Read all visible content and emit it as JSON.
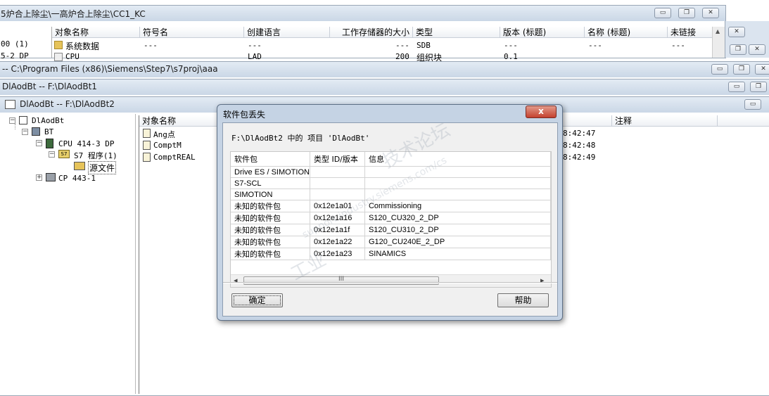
{
  "win1": {
    "title": "5炉合上除尘\\一高炉合上除尘\\CC1_KC",
    "columns": [
      "对象名称",
      "符号名",
      "创建语言",
      "工作存储器的大小",
      "类型",
      "版本 (标题)",
      "名称 (标题)",
      "未链接"
    ],
    "row1": {
      "name": "系统数据",
      "symbol": "---",
      "lang": "---",
      "size": "---",
      "type": "SDB",
      "version": "---",
      "title_name": "---",
      "unlinked": "---"
    },
    "row2": {
      "name": "CPU",
      "lang": "LAD",
      "size": "200",
      "type": "组织块",
      "version": "0.1"
    },
    "left_items": [
      "00 (1)",
      "5-2 DP"
    ]
  },
  "win2": {
    "title": "-- C:\\Program Files (x86)\\Siemens\\Step7\\s7proj\\aaa"
  },
  "win3": {
    "title": "DlAodBt -- F:\\DlAodBt1"
  },
  "win4": {
    "title": "DlAodBt -- F:\\DlAodBt2",
    "tree": [
      "DlAodBt",
      "BT",
      "CPU 414-3 DP",
      "S7 程序(1)",
      "源文件",
      "CP 443-1"
    ],
    "columns": {
      "name": "对象名称",
      "comment": "注释"
    },
    "objects": [
      "Ang点",
      "ComptM",
      "ComptREAL"
    ],
    "times": [
      "8:42:47",
      "8:42:48",
      "8:42:49"
    ]
  },
  "dialog": {
    "title": "软件包丢失",
    "message": "F:\\DlAodBt2 中的 项目 'DlAodBt'",
    "headers": [
      "软件包",
      "类型 ID/版本",
      "信息"
    ],
    "rows": [
      [
        "Drive ES / SIMOTION",
        "",
        ""
      ],
      [
        "S7-SCL",
        "",
        ""
      ],
      [
        "SIMOTION",
        "",
        ""
      ],
      [
        "未知的软件包",
        "0x12e1a01",
        "Commissioning"
      ],
      [
        "未知的软件包",
        "0x12e1a16",
        "S120_CU320_2_DP"
      ],
      [
        "未知的软件包",
        "0x12e1a1f",
        "S120_CU310_2_DP"
      ],
      [
        "未知的软件包",
        "0x12e1a22",
        "G120_CU240E_2_DP"
      ],
      [
        "未知的软件包",
        "0x12e1a23",
        "SINAMICS"
      ]
    ],
    "scroll_grip": "III",
    "ok_label": "确定",
    "help_label": "帮助",
    "close_glyph": "x"
  },
  "watermark": [
    "工业",
    "技术论坛",
    "support.industry.siemens.com/cs"
  ],
  "icons": {
    "minimize": "▭",
    "restore": "❐",
    "close": "✕",
    "scroll_up": "▲",
    "scroll_left": "◂",
    "scroll_right": "▸"
  }
}
